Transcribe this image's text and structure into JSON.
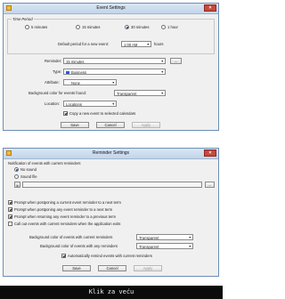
{
  "event_settings": {
    "title": "Event Settings",
    "time_period": {
      "legend": "Time Period",
      "options": [
        "5 minutes",
        "15 minutes",
        "30 minutes",
        "1 hour"
      ],
      "selected": "30 minutes"
    },
    "default_period_label": "Default period for a new event:",
    "default_period_value": "1:00 AM",
    "hours_label": "hours",
    "reminder_label": "Reminder:",
    "reminder_value": "15 minutes",
    "reminder_more": "...",
    "type_label": "Type:",
    "type_value": "Business",
    "attribute_label": "Attribute:",
    "attribute_value": "None",
    "bg_color_label": "Background color for events found:",
    "bg_color_value": "Transparent",
    "location_label": "Location:",
    "location_value": "Locations",
    "copy_new_event_label": "Copy a new event to selected calendars",
    "buttons": {
      "save": "Save",
      "cancel": "Cancel",
      "apply": "Apply"
    }
  },
  "reminder_settings": {
    "title": "Reminder Settings",
    "notification_header": "Notification of events with current reminders",
    "no_sound": "No sound",
    "sound_file": "Sound file",
    "checks": [
      "Prompt when postponing a current event reminder to a next term",
      "Prompt when postponing any event reminder to a next term",
      "Prompt when returning any event reminder to a previous term",
      "Call out events with current reminders when the application exits"
    ],
    "bg_current_label": "Background color of events with current reminders",
    "bg_current_value": "Transparent",
    "bg_any_label": "Background color of events with any reminders",
    "bg_any_value": "Transparent",
    "auto_remind_label": "Automatically remind events with current reminders",
    "buttons": {
      "save": "Save",
      "cancel": "Cancel",
      "apply": "Apply"
    }
  },
  "footer_caption": "Klik za veću"
}
